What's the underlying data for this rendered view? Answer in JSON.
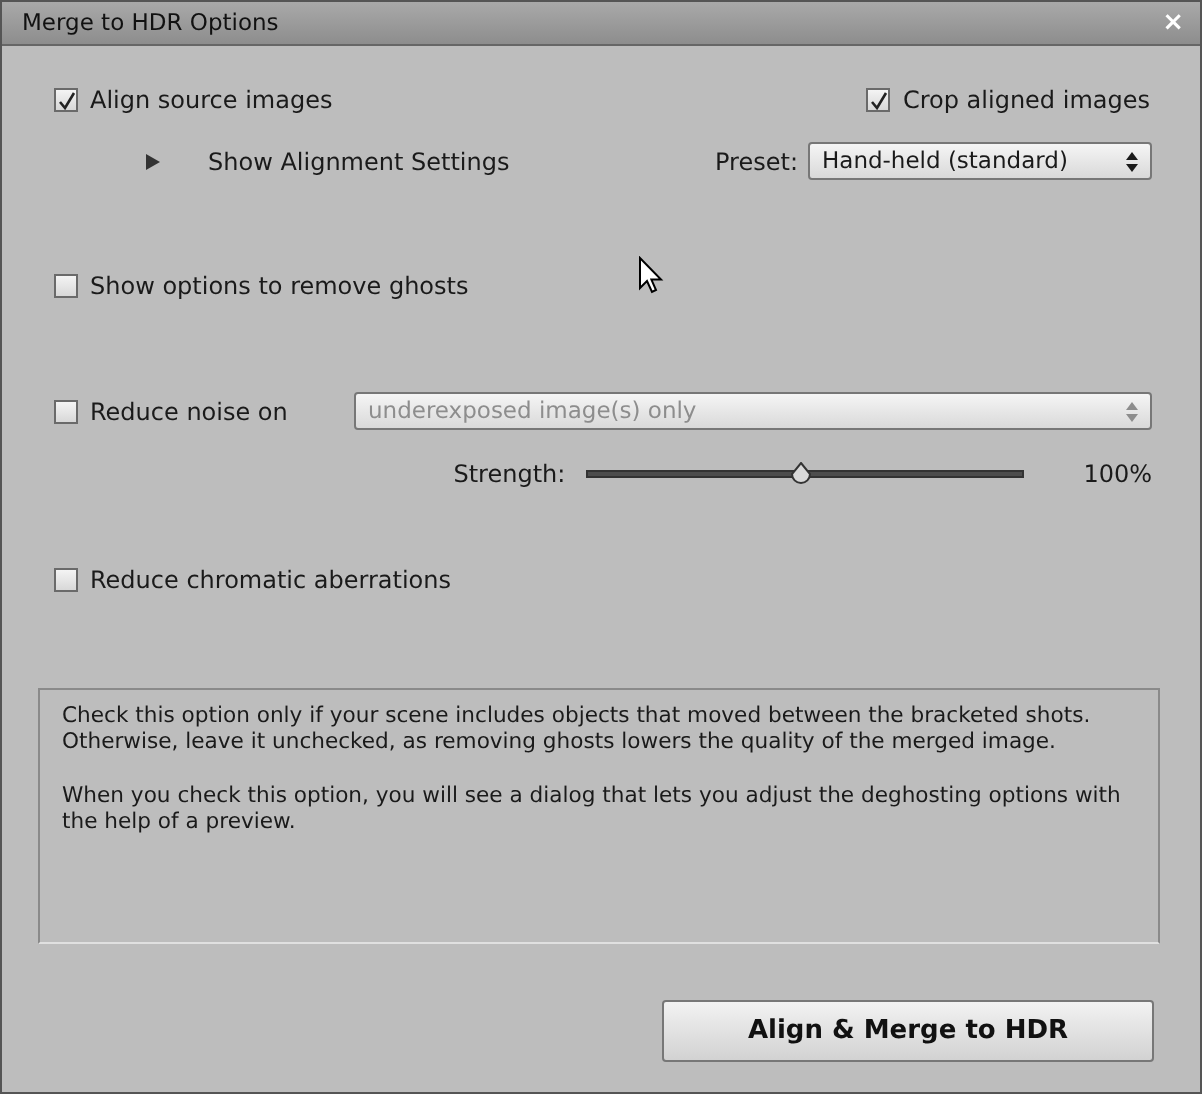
{
  "window": {
    "title": "Merge to HDR Options",
    "close": "×"
  },
  "align": {
    "label": "Align source images",
    "checked": true
  },
  "crop": {
    "label": "Crop aligned images",
    "checked": true
  },
  "alignment_settings": {
    "label": "Show Alignment Settings",
    "expanded": false
  },
  "preset": {
    "label": "Preset:",
    "value": "Hand-held (standard)"
  },
  "ghosts": {
    "label": "Show options to remove ghosts",
    "checked": false
  },
  "noise": {
    "label": "Reduce noise on",
    "checked": false,
    "value": "underexposed image(s) only",
    "disabled": true
  },
  "strength": {
    "label": "Strength:",
    "level": 0.49,
    "reading": "100%"
  },
  "chromatic": {
    "label": "Reduce chromatic aberrations",
    "checked": false
  },
  "help": [
    "Check this option only if your scene includes objects that moved between the bracketed shots. Otherwise, leave it unchecked, as removing ghosts lowers the quality of the merged image.",
    "When you check this option, you will see a dialog that lets you adjust the deghosting options with the help of a preview."
  ],
  "buttons": [
    "Align & Merge to HDR"
  ]
}
